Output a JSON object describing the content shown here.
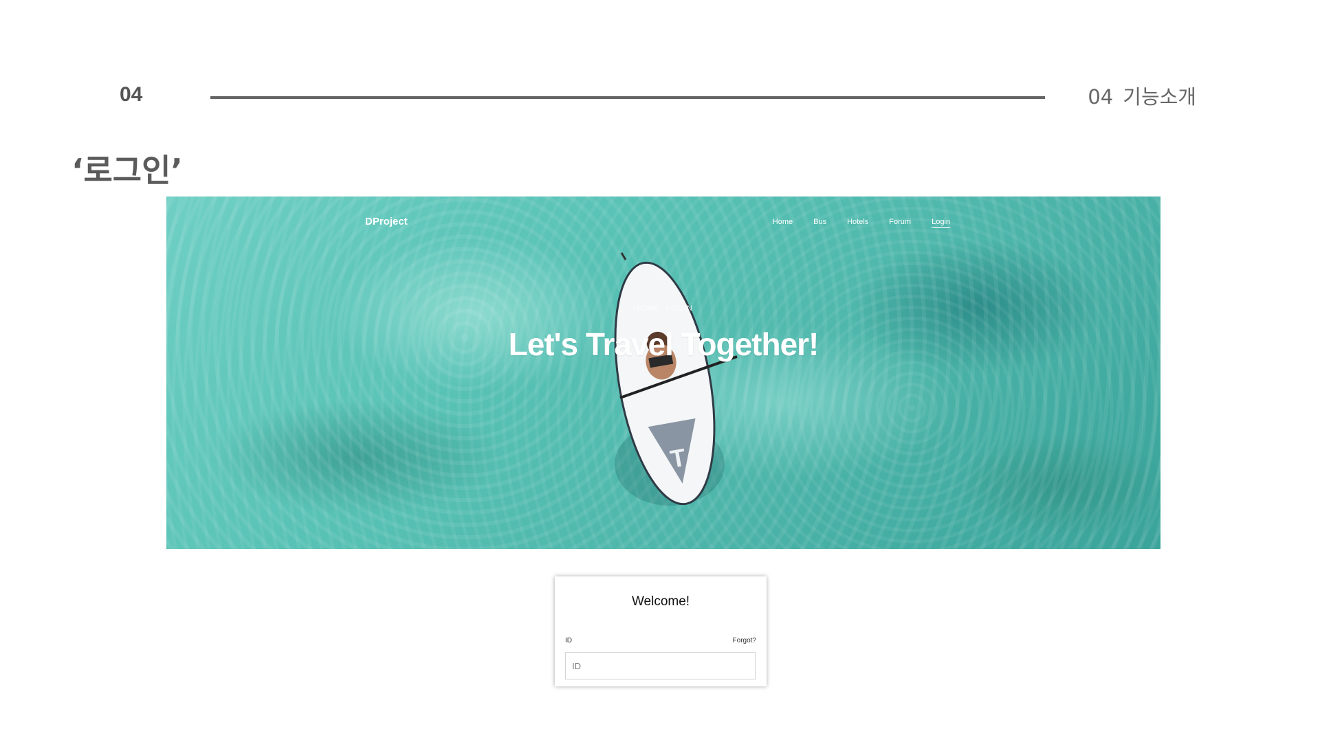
{
  "slide": {
    "section_number": "04",
    "section_title_num": "04",
    "section_title_text": "기능소개",
    "title": "‘로그인’"
  },
  "site": {
    "logo": "DProject",
    "nav": [
      "Home",
      "Bus",
      "Hotels",
      "Forum",
      "Login"
    ],
    "breadcrumb": [
      "HOME",
      "LOGIN"
    ],
    "hero_heading": "Let's Travel Together!"
  },
  "login_card": {
    "welcome": "Welcome!",
    "id_label": "ID",
    "forgot_label": "Forgot?",
    "id_placeholder": "ID",
    "id_value": ""
  },
  "colors": {
    "water": "#59c2b6",
    "text_gray": "#5b5b5b"
  }
}
